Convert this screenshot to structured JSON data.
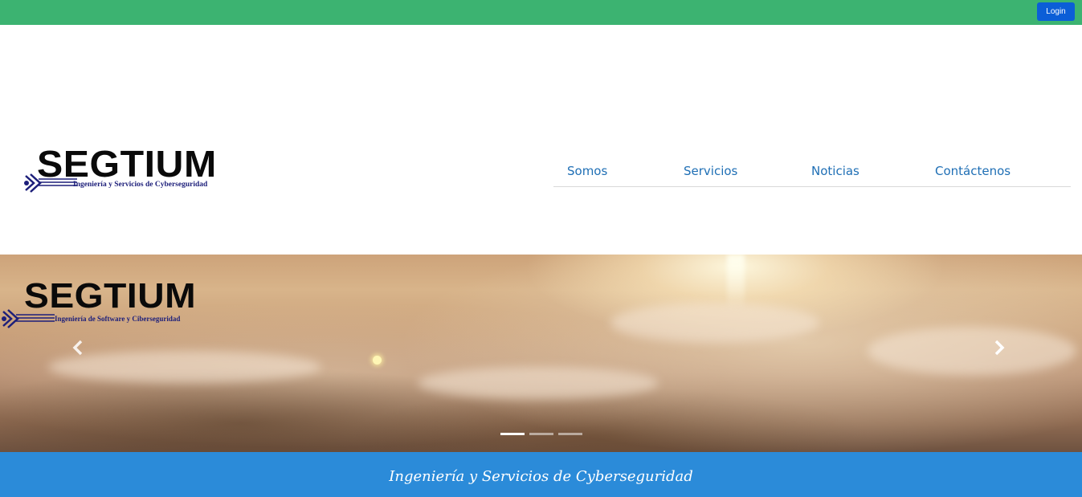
{
  "topbar": {
    "login_label": "Login",
    "color": "#3cb371"
  },
  "brand": {
    "name": "SEGTIUM",
    "tagline": "Ingeniería y Servicios de Cyberseguridad"
  },
  "nav": {
    "items": [
      {
        "label": "Somos"
      },
      {
        "label": "Servicios"
      },
      {
        "label": "Noticias"
      },
      {
        "label": "Contáctenos"
      }
    ]
  },
  "hero": {
    "logo_name": "SEGTIUM",
    "logo_tagline": "Ingeniería de Software y Ciberseguridad",
    "prev_icon": "chevron-left-icon",
    "next_icon": "chevron-right-icon",
    "slides_count": 3,
    "active_slide": 1
  },
  "banner": {
    "text": "Ingeniería y Servicios de Cyberseguridad",
    "color": "#2b8bd9"
  }
}
